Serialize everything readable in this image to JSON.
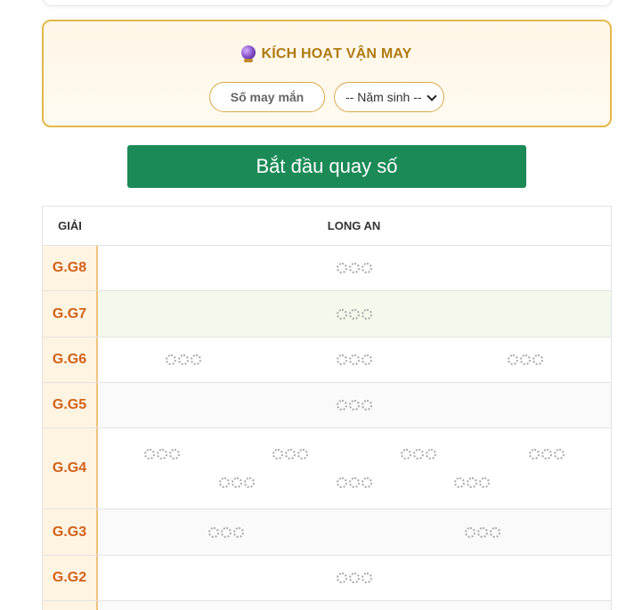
{
  "lucky": {
    "title": "KÍCH HOẠT VẬN MAY",
    "lucky_number_placeholder": "Số may mắn",
    "year_select_value": "-- Năm sinh --"
  },
  "spin_button_label": "Bắt đầu quay số",
  "table": {
    "col_prize": "GIẢI",
    "col_province": "LONG AN",
    "rows": [
      {
        "label": "G.G8",
        "count": 1
      },
      {
        "label": "G.G7",
        "count": 1
      },
      {
        "label": "G.G6",
        "count": 3
      },
      {
        "label": "G.G5",
        "count": 1
      },
      {
        "label": "G.G4",
        "count": 7
      },
      {
        "label": "G.G3",
        "count": 2
      },
      {
        "label": "G.G2",
        "count": 1
      }
    ]
  },
  "colors": {
    "accent_green": "#1b8a57",
    "prize_label": "#d2601a",
    "gold_border": "#e4b84a"
  },
  "icons": {
    "lucky_icon": "crystal-ball-icon",
    "loading_icon": "spinner-icon"
  }
}
